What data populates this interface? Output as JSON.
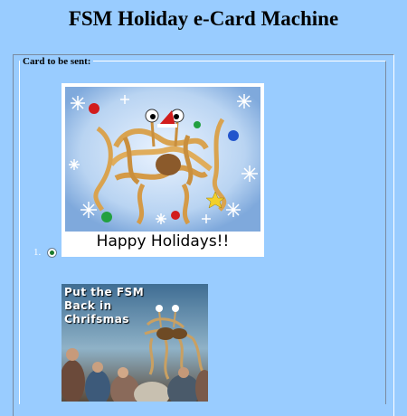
{
  "page": {
    "title": "FSM Holiday e-Card Machine"
  },
  "form": {
    "legend": "Card to be sent:"
  },
  "cards": [
    {
      "number": "1.",
      "image_text": "Happy Holidays!!",
      "selected": true,
      "icon": "fsm-holiday-card-image"
    },
    {
      "image_text": "Put the FSM\nBack in\nChrifsmas",
      "icon": "fsm-chrifsmas-card-image"
    }
  ]
}
